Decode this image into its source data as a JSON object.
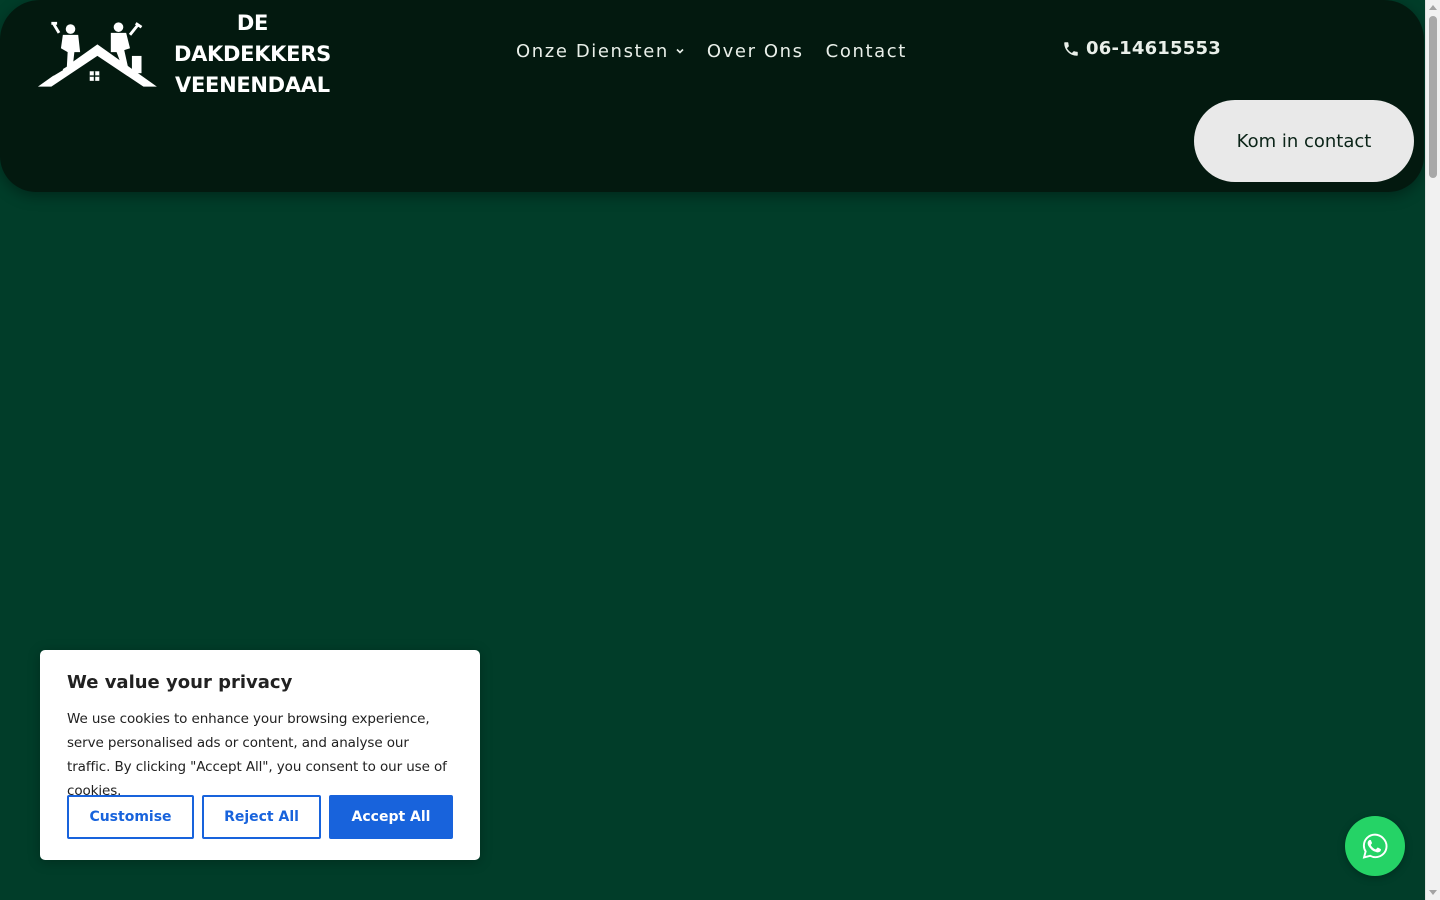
{
  "brand": {
    "line1": "DE DAKDEKKERS",
    "line2": "VEENENDAAL",
    "logo_icon": "roofers-on-roof-icon"
  },
  "nav": {
    "items": [
      {
        "label": "Onze Diensten",
        "has_dropdown": true
      },
      {
        "label": "Over Ons",
        "has_dropdown": false
      },
      {
        "label": "Contact",
        "has_dropdown": false
      }
    ]
  },
  "phone": {
    "number": "06-14615553",
    "icon": "phone-icon"
  },
  "cta": {
    "label": "Kom in contact"
  },
  "cookie_banner": {
    "title": "We value your privacy",
    "body": "We use cookies to enhance your browsing experience, serve personalised ads or content, and analyse our traffic. By clicking \"Accept All\", you consent to our use of cookies.",
    "customise_label": "Customise",
    "reject_label": "Reject All",
    "accept_label": "Accept All"
  },
  "floating": {
    "icon": "whatsapp-icon"
  },
  "colors": {
    "page_bg": "#013d29",
    "header_bg": "#03190f",
    "cta_bg": "#e9e9e9",
    "cookie_accent": "#1863dc",
    "whatsapp": "#25d366"
  }
}
